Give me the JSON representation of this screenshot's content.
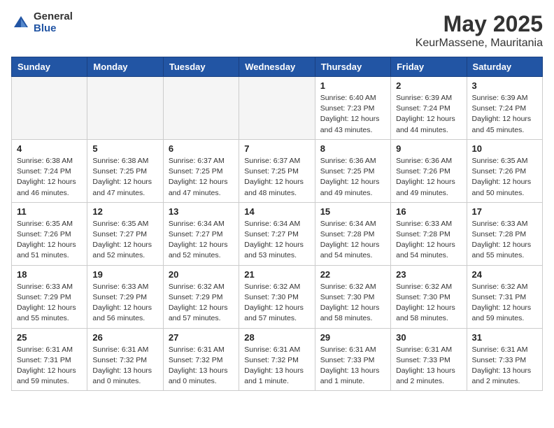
{
  "logo": {
    "general": "General",
    "blue": "Blue"
  },
  "header": {
    "month": "May 2025",
    "location": "KeurMassene, Mauritania"
  },
  "weekdays": [
    "Sunday",
    "Monday",
    "Tuesday",
    "Wednesday",
    "Thursday",
    "Friday",
    "Saturday"
  ],
  "weeks": [
    [
      {
        "day": "",
        "info": ""
      },
      {
        "day": "",
        "info": ""
      },
      {
        "day": "",
        "info": ""
      },
      {
        "day": "",
        "info": ""
      },
      {
        "day": "1",
        "info": "Sunrise: 6:40 AM\nSunset: 7:23 PM\nDaylight: 12 hours\nand 43 minutes."
      },
      {
        "day": "2",
        "info": "Sunrise: 6:39 AM\nSunset: 7:24 PM\nDaylight: 12 hours\nand 44 minutes."
      },
      {
        "day": "3",
        "info": "Sunrise: 6:39 AM\nSunset: 7:24 PM\nDaylight: 12 hours\nand 45 minutes."
      }
    ],
    [
      {
        "day": "4",
        "info": "Sunrise: 6:38 AM\nSunset: 7:24 PM\nDaylight: 12 hours\nand 46 minutes."
      },
      {
        "day": "5",
        "info": "Sunrise: 6:38 AM\nSunset: 7:25 PM\nDaylight: 12 hours\nand 47 minutes."
      },
      {
        "day": "6",
        "info": "Sunrise: 6:37 AM\nSunset: 7:25 PM\nDaylight: 12 hours\nand 47 minutes."
      },
      {
        "day": "7",
        "info": "Sunrise: 6:37 AM\nSunset: 7:25 PM\nDaylight: 12 hours\nand 48 minutes."
      },
      {
        "day": "8",
        "info": "Sunrise: 6:36 AM\nSunset: 7:25 PM\nDaylight: 12 hours\nand 49 minutes."
      },
      {
        "day": "9",
        "info": "Sunrise: 6:36 AM\nSunset: 7:26 PM\nDaylight: 12 hours\nand 49 minutes."
      },
      {
        "day": "10",
        "info": "Sunrise: 6:35 AM\nSunset: 7:26 PM\nDaylight: 12 hours\nand 50 minutes."
      }
    ],
    [
      {
        "day": "11",
        "info": "Sunrise: 6:35 AM\nSunset: 7:26 PM\nDaylight: 12 hours\nand 51 minutes."
      },
      {
        "day": "12",
        "info": "Sunrise: 6:35 AM\nSunset: 7:27 PM\nDaylight: 12 hours\nand 52 minutes."
      },
      {
        "day": "13",
        "info": "Sunrise: 6:34 AM\nSunset: 7:27 PM\nDaylight: 12 hours\nand 52 minutes."
      },
      {
        "day": "14",
        "info": "Sunrise: 6:34 AM\nSunset: 7:27 PM\nDaylight: 12 hours\nand 53 minutes."
      },
      {
        "day": "15",
        "info": "Sunrise: 6:34 AM\nSunset: 7:28 PM\nDaylight: 12 hours\nand 54 minutes."
      },
      {
        "day": "16",
        "info": "Sunrise: 6:33 AM\nSunset: 7:28 PM\nDaylight: 12 hours\nand 54 minutes."
      },
      {
        "day": "17",
        "info": "Sunrise: 6:33 AM\nSunset: 7:28 PM\nDaylight: 12 hours\nand 55 minutes."
      }
    ],
    [
      {
        "day": "18",
        "info": "Sunrise: 6:33 AM\nSunset: 7:29 PM\nDaylight: 12 hours\nand 55 minutes."
      },
      {
        "day": "19",
        "info": "Sunrise: 6:33 AM\nSunset: 7:29 PM\nDaylight: 12 hours\nand 56 minutes."
      },
      {
        "day": "20",
        "info": "Sunrise: 6:32 AM\nSunset: 7:29 PM\nDaylight: 12 hours\nand 57 minutes."
      },
      {
        "day": "21",
        "info": "Sunrise: 6:32 AM\nSunset: 7:30 PM\nDaylight: 12 hours\nand 57 minutes."
      },
      {
        "day": "22",
        "info": "Sunrise: 6:32 AM\nSunset: 7:30 PM\nDaylight: 12 hours\nand 58 minutes."
      },
      {
        "day": "23",
        "info": "Sunrise: 6:32 AM\nSunset: 7:30 PM\nDaylight: 12 hours\nand 58 minutes."
      },
      {
        "day": "24",
        "info": "Sunrise: 6:32 AM\nSunset: 7:31 PM\nDaylight: 12 hours\nand 59 minutes."
      }
    ],
    [
      {
        "day": "25",
        "info": "Sunrise: 6:31 AM\nSunset: 7:31 PM\nDaylight: 12 hours\nand 59 minutes."
      },
      {
        "day": "26",
        "info": "Sunrise: 6:31 AM\nSunset: 7:32 PM\nDaylight: 13 hours\nand 0 minutes."
      },
      {
        "day": "27",
        "info": "Sunrise: 6:31 AM\nSunset: 7:32 PM\nDaylight: 13 hours\nand 0 minutes."
      },
      {
        "day": "28",
        "info": "Sunrise: 6:31 AM\nSunset: 7:32 PM\nDaylight: 13 hours\nand 1 minute."
      },
      {
        "day": "29",
        "info": "Sunrise: 6:31 AM\nSunset: 7:33 PM\nDaylight: 13 hours\nand 1 minute."
      },
      {
        "day": "30",
        "info": "Sunrise: 6:31 AM\nSunset: 7:33 PM\nDaylight: 13 hours\nand 2 minutes."
      },
      {
        "day": "31",
        "info": "Sunrise: 6:31 AM\nSunset: 7:33 PM\nDaylight: 13 hours\nand 2 minutes."
      }
    ]
  ]
}
